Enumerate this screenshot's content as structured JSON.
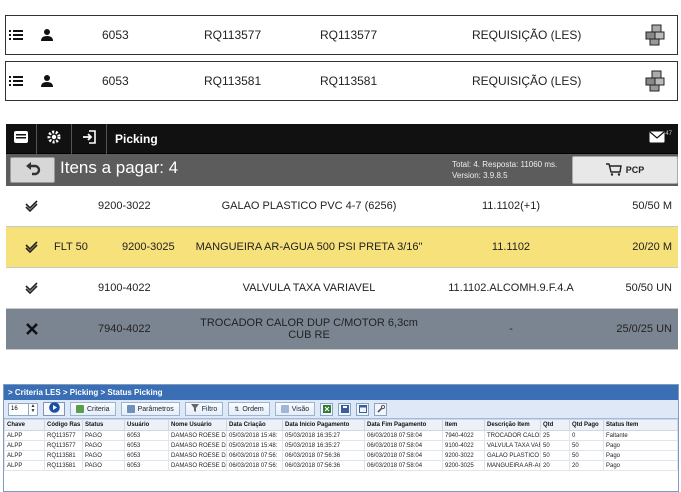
{
  "requisitions": [
    {
      "number": "6053",
      "code1": "RQ113577",
      "code2": "RQ113577",
      "type": "REQUISIÇÃO (LES)"
    },
    {
      "number": "6053",
      "code1": "RQ113581",
      "code2": "RQ113581",
      "type": "REQUISIÇÃO (LES)"
    }
  ],
  "appbar": {
    "title": "Picking",
    "mail_count": "47"
  },
  "subbar": {
    "items_title": "Itens a pagar: 4",
    "status_line1": "Total: 4. Resposta: 11060 ms.",
    "status_line2": "Version: 3.9.8.5",
    "pcp_label": "PCP"
  },
  "pick_items": [
    {
      "state": "check",
      "location": "",
      "code": "9200-3022",
      "description": "GALAO PLASTICO PVC 4-7 (6256)",
      "ref": "11.1102(+1)",
      "qty": "50/50 M"
    },
    {
      "state": "check",
      "location": "FLT 50",
      "code": "9200-3025",
      "description": "MANGUEIRA AR-AGUA 500 PSI PRETA 3/16\"",
      "ref": "11.1102",
      "qty": "20/20 M"
    },
    {
      "state": "check",
      "location": "",
      "code": "9100-4022",
      "description": "VALVULA TAXA VARIAVEL",
      "ref": "11.1102.ALCOMH.9.F.4.A",
      "qty": "50/50 UN"
    },
    {
      "state": "cross",
      "location": "",
      "code": "7940-4022",
      "description": "TROCADOR CALOR DUP C/MOTOR 6,3cm CUB RE",
      "ref": "-",
      "qty": "25/0/25 UN"
    }
  ],
  "grid": {
    "breadcrumb": "> Criteria LES > Picking > Status Picking",
    "page_size": "16",
    "buttons": {
      "criteria": "Criteria",
      "params": "Parâmetros",
      "filter": "Filtro",
      "order": "Ordem",
      "view": "Visão"
    },
    "columns": [
      "Chave",
      "Código Ras",
      "Status",
      "Usuário",
      "Nome Usuário",
      "Data Criação",
      "Data Inicio Pagamento",
      "Data Fim Pagamento",
      "Item",
      "Descrição Item",
      "Qtd",
      "Qtd Pago",
      "Status Item"
    ],
    "rows": [
      [
        "ALPP",
        "RQ113577",
        "PAGO",
        "6053",
        "DAMASO ROESE DA",
        "05/03/2018 15:48:",
        "05/03/2018 16:35:27",
        "06/03/2018 07:58:04",
        "7940-4022",
        "TROCADOR CALOR D",
        "25",
        "0",
        "Faltante"
      ],
      [
        "ALPP",
        "RQ113577",
        "PAGO",
        "6053",
        "DAMASO ROESE DA",
        "05/03/2018 15:48:",
        "05/03/2018 16:35:27",
        "06/03/2018 07:58:04",
        "9100-4022",
        "VALVULA TAXA VARI",
        "50",
        "50",
        "Pago"
      ],
      [
        "ALPP",
        "RQ113581",
        "PAGO",
        "6053",
        "DAMASO ROESE DA",
        "06/03/2018 07:56:",
        "06/03/2018 07:56:36",
        "06/03/2018 07:58:04",
        "9200-3022",
        "GALAO PLASTICO PV",
        "50",
        "50",
        "Pago"
      ],
      [
        "ALPP",
        "RQ113581",
        "PAGO",
        "6053",
        "DAMASO ROESE DA",
        "06/03/2018 07:56:",
        "06/03/2018 07:56:36",
        "06/03/2018 07:58:04",
        "9200-3025",
        "MANGUEIRA AR-AGUA",
        "20",
        "20",
        "Pago"
      ]
    ]
  }
}
